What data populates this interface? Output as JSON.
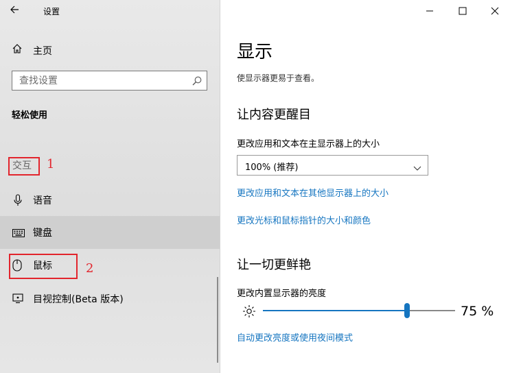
{
  "window": {
    "title": "设置",
    "controls": [
      "minimize-icon",
      "maximize-icon",
      "close-icon"
    ]
  },
  "sidebar": {
    "home_label": "主页",
    "search_placeholder": "查找设置",
    "section_title": "轻松使用",
    "group_label": "交互",
    "items": [
      {
        "label": "语音",
        "icon": "microphone-icon"
      },
      {
        "label": "键盘",
        "icon": "keyboard-icon",
        "selected": true
      },
      {
        "label": "鼠标",
        "icon": "mouse-icon"
      },
      {
        "label": "目视控制(Beta 版本)",
        "icon": "eye-control-icon"
      }
    ],
    "annotations": [
      "1",
      "2"
    ]
  },
  "main": {
    "title": "显示",
    "subtitle": "使显示器更易于查看。",
    "section1": {
      "heading": "让内容更醒目",
      "size_label": "更改应用和文本在主显示器上的大小",
      "size_value": "100% (推荐)",
      "link1": "更改应用和文本在其他显示器上的大小",
      "link2": "更改光标和鼠标指针的大小和颜色"
    },
    "section2": {
      "heading": "让一切更鲜艳",
      "brightness_label": "更改内置显示器的亮度",
      "brightness_value": 75,
      "brightness_text": "75 %",
      "link": "自动更改亮度或使用夜间模式"
    }
  },
  "colors": {
    "accent": "#1575c0",
    "annotation_red": "#e2242c"
  }
}
